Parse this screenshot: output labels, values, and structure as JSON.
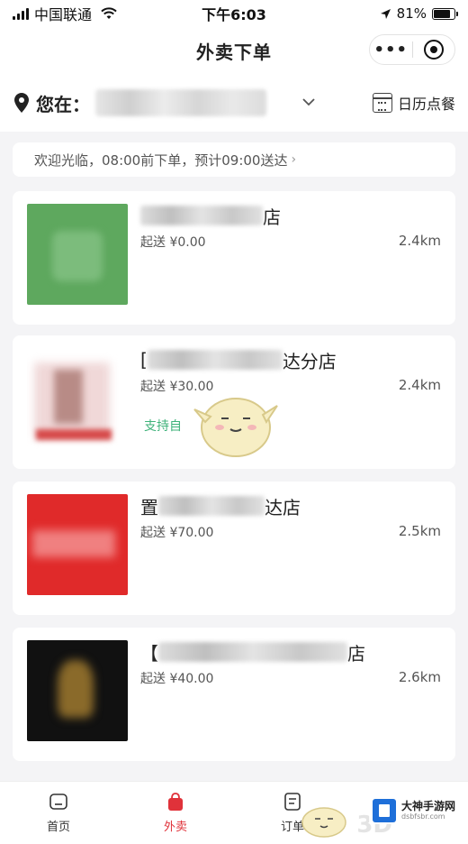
{
  "status": {
    "carrier": "中国联通",
    "time": "下午6:03",
    "battery": "81%",
    "battery_level": 0.81
  },
  "nav": {
    "title": "外卖下单",
    "more_icon": "more-dots-icon",
    "target_icon": "target-icon"
  },
  "location": {
    "label": "您在：",
    "calendar_label": "日历点餐"
  },
  "notice": {
    "text": "欢迎光临，08:00前下单，预计09:00送达"
  },
  "stores": [
    {
      "name_suffix": "店",
      "min_order": "起送 ¥0.00",
      "distance": "2.4km",
      "thumb_color": "#5ea85e"
    },
    {
      "name_prefix": "[",
      "name_suffix": "达分店",
      "min_order": "起送 ¥30.00",
      "distance": "2.4km",
      "tag": "支持自",
      "thumb_color": "#f2dede"
    },
    {
      "name_prefix": "置",
      "name_suffix": "达店",
      "min_order": "起送 ¥70.00",
      "distance": "2.5km",
      "thumb_color": "#e02a2a"
    },
    {
      "name_prefix": "【",
      "name_suffix": "店",
      "min_order": "起送 ¥40.00",
      "distance": "2.6km",
      "thumb_color": "#111111"
    }
  ],
  "tabs": [
    {
      "label": "首页",
      "icon": "home-icon"
    },
    {
      "label": "外卖",
      "icon": "takeout-bag-icon",
      "active": true
    },
    {
      "label": "订单",
      "icon": "order-list-icon"
    }
  ],
  "watermark": {
    "name": "大神手游网",
    "url": "dsbfsbr.com",
    "logo_text": "3D"
  },
  "colors": {
    "accent": "#e0323a",
    "pickup_tag": "#3fb27a",
    "background": "#f4f4f6"
  }
}
